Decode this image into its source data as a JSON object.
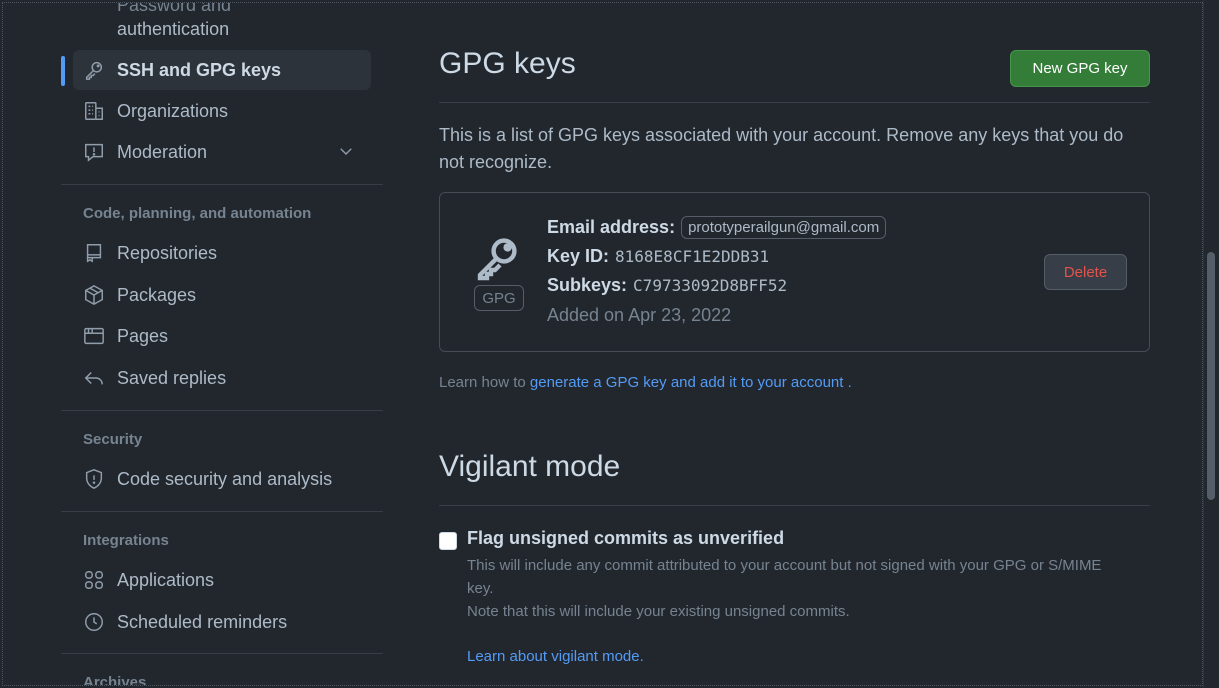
{
  "sidebar": {
    "partial_top_label_line1": "Password and",
    "partial_top_label_line2": "authentication",
    "items": {
      "ssh_gpg": "SSH and GPG keys",
      "organizations": "Organizations",
      "moderation": "Moderation",
      "repositories": "Repositories",
      "packages": "Packages",
      "pages": "Pages",
      "saved_replies": "Saved replies",
      "code_security": "Code security and analysis",
      "applications": "Applications",
      "scheduled_reminders": "Scheduled reminders"
    },
    "headings": {
      "code_planning": "Code, planning, and automation",
      "security": "Security",
      "integrations": "Integrations",
      "archives": "Archives"
    }
  },
  "main": {
    "gpg_title": "GPG keys",
    "new_key_button": "New GPG key",
    "description": "This is a list of GPG keys associated with your account. Remove any keys that you do not recognize.",
    "key": {
      "badge": "GPG",
      "email_label": "Email address:",
      "email_value": "prototyperailgun@gmail.com",
      "keyid_label": "Key ID:",
      "keyid_value": "8168E8CF1E2DDB31",
      "subkeys_label": "Subkeys:",
      "subkeys_value": "C79733092D8BFF52",
      "added": "Added on Apr 23, 2022",
      "delete_button": "Delete"
    },
    "learn_prefix": "Learn how to",
    "learn_link": "generate a GPG key and add it to your account",
    "learn_suffix": ".",
    "vigilant_title": "Vigilant mode",
    "flag_label": "Flag unsigned commits as unverified",
    "flag_desc_1": "This will include any commit attributed to your account but not signed with your GPG or S/MIME key.",
    "flag_desc_2": "Note that this will include your existing unsigned commits.",
    "learn_vigilant": "Learn about vigilant mode."
  },
  "colors": {
    "background": "#22272e",
    "accent": "#539bf5",
    "primary_button": "#347d39",
    "danger": "#e5534b"
  }
}
